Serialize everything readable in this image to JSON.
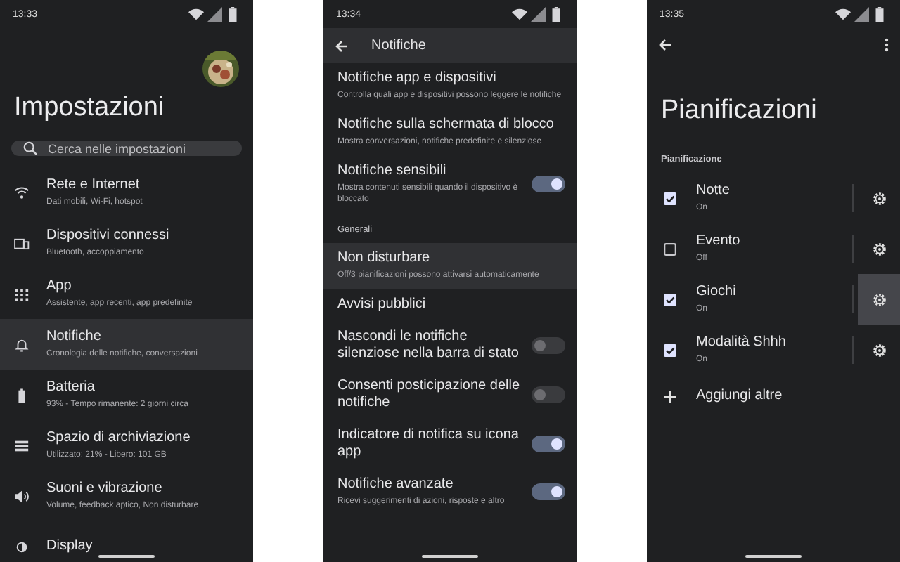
{
  "settings_screen": {
    "status_time": "13:33",
    "title": "Impostazioni",
    "search": {
      "placeholder": "Cerca nelle impostazioni"
    },
    "items": [
      {
        "title": "Rete e Internet",
        "subtitle": "Dati mobili, Wi-Fi, hotspot",
        "selected": false
      },
      {
        "title": "Dispositivi connessi",
        "subtitle": "Bluetooth, accoppiamento",
        "selected": false
      },
      {
        "title": "App",
        "subtitle": "Assistente, app recenti, app predefinite",
        "selected": false
      },
      {
        "title": "Notifiche",
        "subtitle": "Cronologia delle notifiche, conversazioni",
        "selected": true
      },
      {
        "title": "Batteria",
        "subtitle": "93% - Tempo rimanente: 2 giorni circa",
        "selected": false
      },
      {
        "title": "Spazio di archiviazione",
        "subtitle": "Utilizzato: 21% - Libero: 101 GB",
        "selected": false
      },
      {
        "title": "Suoni e vibrazione",
        "subtitle": "Volume, feedback aptico, Non disturbare",
        "selected": false
      },
      {
        "title": "Display",
        "selected": false
      }
    ]
  },
  "notifications_screen": {
    "status_time": "13:34",
    "title": "Notifiche",
    "items": [
      {
        "kind": "link",
        "title": "Notifiche app e dispositivi",
        "subtitle": "Controlla quali app e dispositivi possono leggere le notifiche",
        "selected": false
      },
      {
        "kind": "link",
        "title": "Notifiche sulla schermata di blocco",
        "subtitle": "Mostra conversazioni, notifiche predefinite e silenziose",
        "selected": false
      },
      {
        "kind": "toggle",
        "title": "Notifiche sensibili",
        "subtitle": "Mostra contenuti sensibili quando il dispositivo è bloccato",
        "on": true,
        "selected": false
      },
      {
        "kind": "header",
        "title": "Generali"
      },
      {
        "kind": "link",
        "title": "Non disturbare",
        "subtitle": "Off/3 pianificazioni possono attivarsi automaticamente",
        "selected": true
      },
      {
        "kind": "link",
        "title": "Avvisi pubblici",
        "selected": false
      },
      {
        "kind": "toggle",
        "title": "Nascondi le notifiche silenziose nella barra di stato",
        "on": false,
        "selected": false
      },
      {
        "kind": "toggle",
        "title": "Consenti posticipazione delle notifiche",
        "on": false,
        "selected": false
      },
      {
        "kind": "toggle",
        "title": "Indicatore di notifica su icona app",
        "on": true,
        "selected": false
      },
      {
        "kind": "toggle",
        "title": "Notifiche avanzate",
        "subtitle": "Ricevi suggerimenti di azioni, risposte e altro",
        "on": true,
        "selected": false
      }
    ]
  },
  "schedules_screen": {
    "status_time": "13:35",
    "title": "Pianificazioni",
    "section": "Pianificazione",
    "items": [
      {
        "title": "Notte",
        "status": "On",
        "checked": true,
        "pressed": false
      },
      {
        "title": "Evento",
        "status": "Off",
        "checked": false,
        "pressed": false
      },
      {
        "title": "Giochi",
        "status": "On",
        "checked": true,
        "pressed": true
      },
      {
        "title": "Modalità Shhh",
        "status": "On",
        "checked": true,
        "pressed": false
      }
    ],
    "add_label": "Aggiungi altre"
  }
}
